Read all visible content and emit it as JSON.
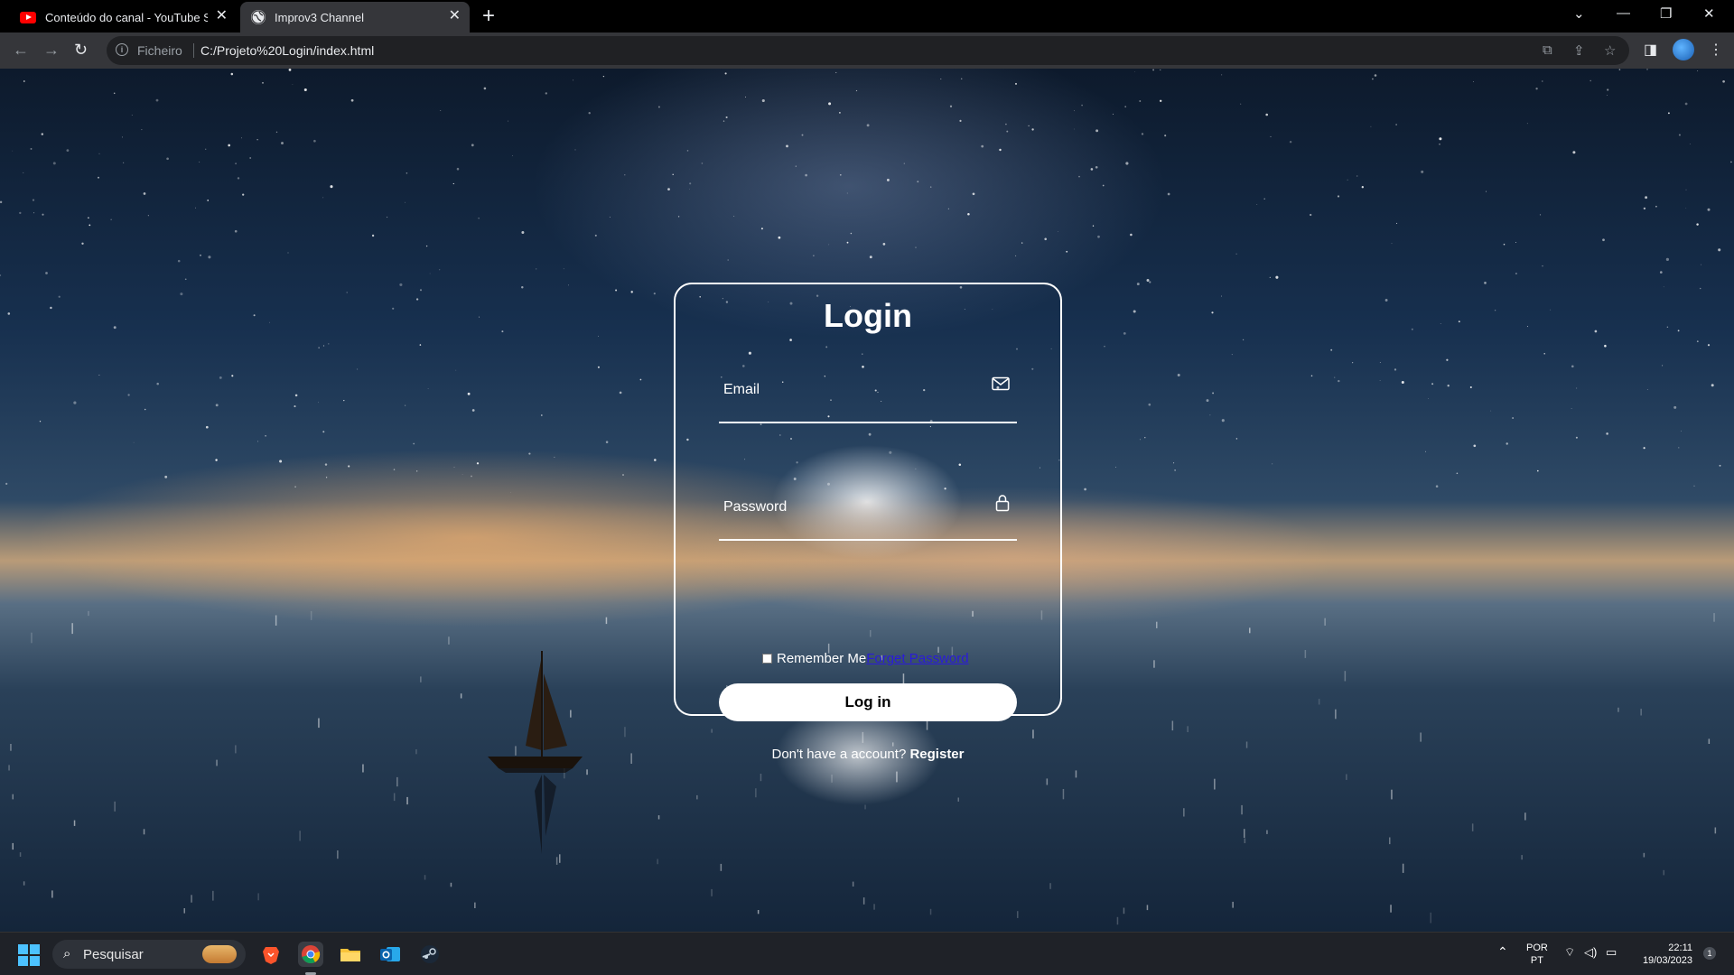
{
  "browser": {
    "tabs": [
      {
        "title": "Conteúdo do canal - YouTube Studio",
        "active": false,
        "favicon": "youtube-icon"
      },
      {
        "title": "Improv3 Channel",
        "active": true,
        "favicon": "globe-icon"
      }
    ],
    "address_bar": {
      "scheme_label": "Ficheiro",
      "url": "C:/Projeto%20Login/index.html"
    }
  },
  "login": {
    "title": "Login",
    "email_placeholder": "Email",
    "password_placeholder": "Password",
    "remember_label": "Remember Me",
    "forgot_label": "Forget Password",
    "submit_label": "Log in",
    "register_prompt": "Don't have a account?",
    "register_link": "Register"
  },
  "taskbar": {
    "search_placeholder": "Pesquisar",
    "apps": [
      "brave-icon",
      "chrome-icon",
      "file-explorer-icon",
      "outlook-icon",
      "steam-icon"
    ],
    "language_top": "POR",
    "language_bottom": "PT",
    "time": "22:11",
    "date": "19/03/2023",
    "notification_count": "1"
  },
  "colors": {
    "chrome_titlebar": "#000000",
    "chrome_toolbar": "#35363a",
    "card_border": "#ffffff",
    "forgot_link": "#2a1bd8",
    "taskbar": "#1f2228"
  }
}
